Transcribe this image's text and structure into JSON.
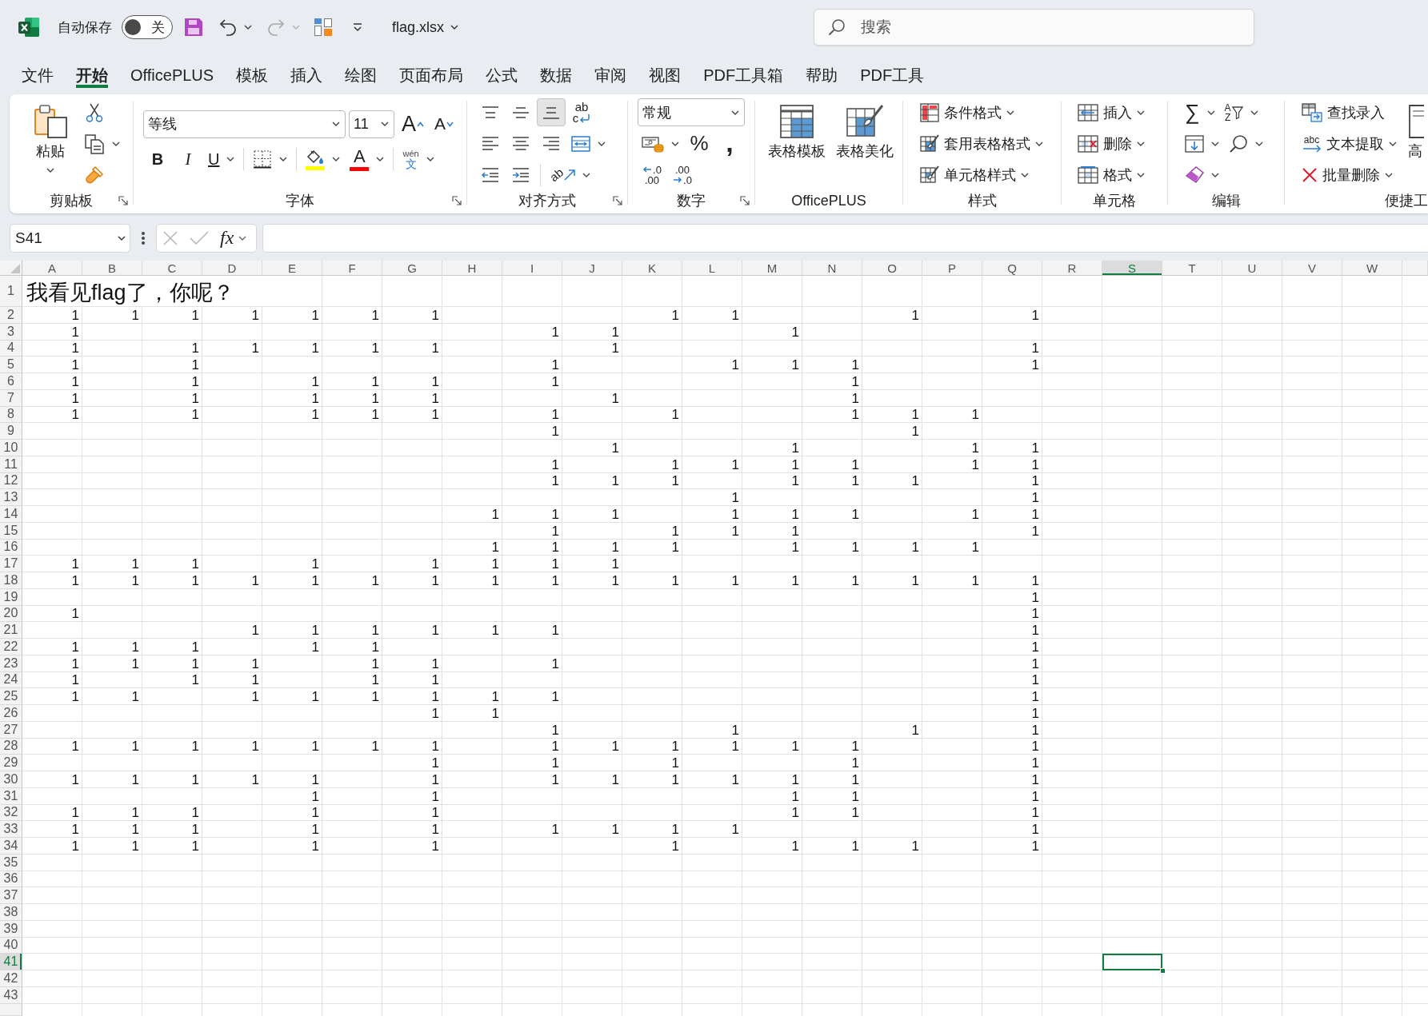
{
  "title_bar": {
    "autosave": {
      "label": "自动保存",
      "on": false,
      "state_text": "关"
    },
    "undo": {
      "disabled": false
    },
    "redo": {
      "disabled": true
    },
    "file_name": "flag.xlsx",
    "search": {
      "placeholder": "搜索"
    }
  },
  "tabs": [
    {
      "label": "文件",
      "selected": false
    },
    {
      "label": "开始",
      "selected": true
    },
    {
      "label": "OfficePLUS",
      "selected": false
    },
    {
      "label": "模板",
      "selected": false
    },
    {
      "label": "插入",
      "selected": false
    },
    {
      "label": "绘图",
      "selected": false
    },
    {
      "label": "页面布局",
      "selected": false
    },
    {
      "label": "公式",
      "selected": false
    },
    {
      "label": "数据",
      "selected": false
    },
    {
      "label": "审阅",
      "selected": false
    },
    {
      "label": "视图",
      "selected": false
    },
    {
      "label": "PDF工具箱",
      "selected": false
    },
    {
      "label": "帮助",
      "selected": false
    },
    {
      "label": "PDF工具",
      "selected": false
    }
  ],
  "ribbon": {
    "groups": [
      {
        "label": "剪贴板",
        "blocks": [
          {
            "kind": "large",
            "label": "粘贴"
          },
          {
            "kind": "stack",
            "lines": [
              {
                "items": [
                  {
                    "kind": "icon"
                  }
                ]
              },
              {
                "items": [
                  {
                    "kind": "icon"
                  }
                ]
              },
              {
                "items": [
                  {
                    "kind": "icon"
                  }
                ]
              }
            ]
          }
        ]
      },
      {
        "label": "字体",
        "blocks": [
          {
            "kind": "stack",
            "lines": [
              {
                "items": [
                  {
                    "kind": "combo",
                    "value": "等线"
                  },
                  {
                    "kind": "combo",
                    "value": "11"
                  },
                  {
                    "kind": "glyph",
                    "text": "A"
                  },
                  {
                    "kind": "glyph",
                    "text": "A"
                  }
                ]
              },
              {
                "items": [
                  {
                    "kind": "glyph",
                    "text": "B"
                  },
                  {
                    "kind": "glyph",
                    "text": "I"
                  },
                  {
                    "kind": "glyph",
                    "text": "U"
                  },
                  {
                    "kind": "divider"
                  },
                  {
                    "kind": "icon"
                  },
                  {
                    "kind": "divider"
                  },
                  {
                    "kind": "icon",
                    "color": "#ffff00"
                  },
                  {
                    "kind": "glyph",
                    "text": "A",
                    "color": "#ff0000"
                  },
                  {
                    "kind": "divider"
                  },
                  {
                    "kind": "glyph",
                    "text": "wén",
                    "subtext": "文"
                  }
                ]
              }
            ]
          }
        ]
      },
      {
        "label": "对齐方式",
        "blocks": [
          {
            "kind": "stack",
            "lines": [
              {
                "items": [
                  {
                    "kind": "icon",
                    "selected": false
                  },
                  {
                    "kind": "icon",
                    "selected": false
                  },
                  {
                    "kind": "icon",
                    "selected": true
                  },
                  {
                    "kind": "glyph",
                    "text": "ab",
                    "subtext": "c",
                    "selected": false
                  }
                ]
              },
              {
                "items": [
                  {
                    "kind": "icon",
                    "selected": false
                  },
                  {
                    "kind": "icon",
                    "selected": false
                  },
                  {
                    "kind": "icon",
                    "selected": false
                  },
                  {
                    "kind": "icon"
                  }
                ]
              },
              {
                "items": [
                  {
                    "kind": "icon"
                  },
                  {
                    "kind": "icon"
                  },
                  {
                    "kind": "divider"
                  },
                  {
                    "kind": "glyph",
                    "text": "ab"
                  }
                ]
              }
            ]
          }
        ]
      },
      {
        "label": "数字",
        "blocks": [
          {
            "kind": "stack",
            "lines": [
              {
                "items": [
                  {
                    "kind": "combo",
                    "value": "常规"
                  }
                ]
              },
              {
                "items": [
                  {
                    "kind": "icon"
                  },
                  {
                    "kind": "glyph",
                    "text": "%"
                  },
                  {
                    "kind": "glyph",
                    "text": ","
                  }
                ]
              },
              {
                "items": [
                  {
                    "kind": "glyph",
                    "text": ".0",
                    "subtext": ".00"
                  },
                  {
                    "kind": "glyph",
                    "text": ".00",
                    "subtext": ".0"
                  }
                ]
              }
            ]
          }
        ]
      },
      {
        "label": "OfficePLUS",
        "blocks": [
          {
            "kind": "large",
            "label": "表格模板"
          },
          {
            "kind": "large",
            "label": "表格美化"
          }
        ]
      },
      {
        "label": "样式",
        "blocks": [
          {
            "kind": "stack",
            "lines": [
              {
                "items": [
                  {
                    "kind": "small",
                    "label": "条件格式"
                  }
                ]
              },
              {
                "items": [
                  {
                    "kind": "small",
                    "label": "套用表格格式"
                  }
                ]
              },
              {
                "items": [
                  {
                    "kind": "small",
                    "label": "单元格样式"
                  }
                ]
              }
            ]
          }
        ]
      },
      {
        "label": "单元格",
        "blocks": [
          {
            "kind": "stack",
            "lines": [
              {
                "items": [
                  {
                    "kind": "small",
                    "label": "插入"
                  }
                ]
              },
              {
                "items": [
                  {
                    "kind": "small",
                    "label": "删除"
                  }
                ]
              },
              {
                "items": [
                  {
                    "kind": "small",
                    "label": "格式"
                  }
                ]
              }
            ]
          }
        ]
      },
      {
        "label": "编辑",
        "blocks": [
          {
            "kind": "stack",
            "lines": [
              {
                "items": [
                  {
                    "kind": "glyph",
                    "text": "∑"
                  },
                  {
                    "kind": "glyph",
                    "text": "A",
                    "subtext": "Z"
                  }
                ]
              },
              {
                "items": [
                  {
                    "kind": "icon"
                  },
                  {
                    "kind": "icon"
                  }
                ]
              },
              {
                "items": [
                  {
                    "kind": "icon"
                  }
                ]
              }
            ]
          }
        ]
      },
      {
        "label": "便捷工",
        "blocks": [
          {
            "kind": "stack",
            "lines": [
              {
                "items": [
                  {
                    "kind": "small",
                    "label": "查找录入"
                  }
                ]
              },
              {
                "items": [
                  {
                    "kind": "small",
                    "label": "文本提取",
                    "glyph": "abc"
                  }
                ]
              },
              {
                "items": [
                  {
                    "kind": "small",
                    "label": "批量删除"
                  }
                ]
              }
            ]
          },
          {
            "kind": "large",
            "label": "高"
          }
        ]
      }
    ]
  },
  "formula_bar": {
    "name_box": "S41",
    "cancel": {
      "disabled": true
    },
    "confirm": {
      "disabled": true
    },
    "function_label": "fx"
  },
  "sheet": {
    "columns": [
      {
        "label": "A",
        "selected": false
      },
      {
        "label": "B",
        "selected": false
      },
      {
        "label": "C",
        "selected": false
      },
      {
        "label": "D",
        "selected": false
      },
      {
        "label": "E",
        "selected": false
      },
      {
        "label": "F",
        "selected": false
      },
      {
        "label": "G",
        "selected": false
      },
      {
        "label": "H",
        "selected": false
      },
      {
        "label": "I",
        "selected": false
      },
      {
        "label": "J",
        "selected": false
      },
      {
        "label": "K",
        "selected": false
      },
      {
        "label": "L",
        "selected": false
      },
      {
        "label": "M",
        "selected": false
      },
      {
        "label": "N",
        "selected": false
      },
      {
        "label": "O",
        "selected": false
      },
      {
        "label": "P",
        "selected": false
      },
      {
        "label": "Q",
        "selected": false
      },
      {
        "label": "R",
        "selected": false
      },
      {
        "label": "S",
        "selected": true
      },
      {
        "label": "T",
        "selected": false
      },
      {
        "label": "U",
        "selected": false
      },
      {
        "label": "V",
        "selected": false
      },
      {
        "label": "W",
        "selected": false
      }
    ],
    "rows": [
      {
        "number": "1",
        "selected": false,
        "kind": "title",
        "cells": [
          "我看见flag了，你呢？"
        ]
      },
      {
        "number": "2",
        "selected": false,
        "kind": "data",
        "cells": [
          "1",
          "1",
          "1",
          "1",
          "1",
          "1",
          "1",
          null,
          null,
          null,
          "1",
          "1",
          null,
          null,
          "1",
          null,
          "1"
        ]
      },
      {
        "number": "3",
        "selected": false,
        "kind": "data",
        "cells": [
          "1",
          null,
          null,
          null,
          null,
          null,
          null,
          null,
          "1",
          "1",
          null,
          null,
          "1"
        ]
      },
      {
        "number": "4",
        "selected": false,
        "kind": "data",
        "cells": [
          "1",
          null,
          "1",
          "1",
          "1",
          "1",
          "1",
          null,
          null,
          "1",
          null,
          null,
          null,
          null,
          null,
          null,
          "1"
        ]
      },
      {
        "number": "5",
        "selected": false,
        "kind": "data",
        "cells": [
          "1",
          null,
          "1",
          null,
          null,
          null,
          null,
          null,
          "1",
          null,
          null,
          "1",
          "1",
          "1",
          null,
          null,
          "1"
        ]
      },
      {
        "number": "6",
        "selected": false,
        "kind": "data",
        "cells": [
          "1",
          null,
          "1",
          null,
          "1",
          "1",
          "1",
          null,
          "1",
          null,
          null,
          null,
          null,
          "1"
        ]
      },
      {
        "number": "7",
        "selected": false,
        "kind": "data",
        "cells": [
          "1",
          null,
          "1",
          null,
          "1",
          "1",
          "1",
          null,
          null,
          "1",
          null,
          null,
          null,
          "1"
        ]
      },
      {
        "number": "8",
        "selected": false,
        "kind": "data",
        "cells": [
          "1",
          null,
          "1",
          null,
          "1",
          "1",
          "1",
          null,
          "1",
          null,
          "1",
          null,
          null,
          "1",
          "1",
          "1"
        ]
      },
      {
        "number": "9",
        "selected": false,
        "kind": "data",
        "cells": [
          null,
          null,
          null,
          null,
          null,
          null,
          null,
          null,
          "1",
          null,
          null,
          null,
          null,
          null,
          "1"
        ]
      },
      {
        "number": "10",
        "selected": false,
        "kind": "data",
        "cells": [
          null,
          null,
          null,
          null,
          null,
          null,
          null,
          null,
          null,
          "1",
          null,
          null,
          "1",
          null,
          null,
          "1",
          "1"
        ]
      },
      {
        "number": "11",
        "selected": false,
        "kind": "data",
        "cells": [
          null,
          null,
          null,
          null,
          null,
          null,
          null,
          null,
          "1",
          null,
          "1",
          "1",
          "1",
          "1",
          null,
          "1",
          "1"
        ]
      },
      {
        "number": "12",
        "selected": false,
        "kind": "data",
        "cells": [
          null,
          null,
          null,
          null,
          null,
          null,
          null,
          null,
          "1",
          "1",
          "1",
          null,
          "1",
          "1",
          "1",
          null,
          "1"
        ]
      },
      {
        "number": "13",
        "selected": false,
        "kind": "data",
        "cells": [
          null,
          null,
          null,
          null,
          null,
          null,
          null,
          null,
          null,
          null,
          null,
          "1",
          null,
          null,
          null,
          null,
          "1"
        ]
      },
      {
        "number": "14",
        "selected": false,
        "kind": "data",
        "cells": [
          null,
          null,
          null,
          null,
          null,
          null,
          null,
          "1",
          "1",
          "1",
          null,
          "1",
          "1",
          "1",
          null,
          "1",
          "1"
        ]
      },
      {
        "number": "15",
        "selected": false,
        "kind": "data",
        "cells": [
          null,
          null,
          null,
          null,
          null,
          null,
          null,
          null,
          "1",
          null,
          "1",
          "1",
          "1",
          null,
          null,
          null,
          "1"
        ]
      },
      {
        "number": "16",
        "selected": false,
        "kind": "data",
        "cells": [
          null,
          null,
          null,
          null,
          null,
          null,
          null,
          "1",
          "1",
          "1",
          "1",
          null,
          "1",
          "1",
          "1",
          "1"
        ]
      },
      {
        "number": "17",
        "selected": false,
        "kind": "data",
        "cells": [
          "1",
          "1",
          "1",
          null,
          "1",
          null,
          "1",
          "1",
          "1",
          "1"
        ]
      },
      {
        "number": "18",
        "selected": false,
        "kind": "data",
        "cells": [
          "1",
          "1",
          "1",
          "1",
          "1",
          "1",
          "1",
          "1",
          "1",
          "1",
          "1",
          "1",
          "1",
          "1",
          "1",
          "1",
          "1"
        ]
      },
      {
        "number": "19",
        "selected": false,
        "kind": "data",
        "cells": [
          null,
          null,
          null,
          null,
          null,
          null,
          null,
          null,
          null,
          null,
          null,
          null,
          null,
          null,
          null,
          null,
          "1"
        ]
      },
      {
        "number": "20",
        "selected": false,
        "kind": "data",
        "cells": [
          "1",
          null,
          null,
          null,
          null,
          null,
          null,
          null,
          null,
          null,
          null,
          null,
          null,
          null,
          null,
          null,
          "1"
        ]
      },
      {
        "number": "21",
        "selected": false,
        "kind": "data",
        "cells": [
          null,
          null,
          null,
          "1",
          "1",
          "1",
          "1",
          "1",
          "1",
          null,
          null,
          null,
          null,
          null,
          null,
          null,
          "1"
        ]
      },
      {
        "number": "22",
        "selected": false,
        "kind": "data",
        "cells": [
          "1",
          "1",
          "1",
          null,
          "1",
          "1",
          null,
          null,
          null,
          null,
          null,
          null,
          null,
          null,
          null,
          null,
          "1"
        ]
      },
      {
        "number": "23",
        "selected": false,
        "kind": "data",
        "cells": [
          "1",
          "1",
          "1",
          "1",
          null,
          "1",
          "1",
          null,
          "1",
          null,
          null,
          null,
          null,
          null,
          null,
          null,
          "1"
        ]
      },
      {
        "number": "24",
        "selected": false,
        "kind": "data",
        "cells": [
          "1",
          null,
          "1",
          "1",
          null,
          "1",
          "1",
          null,
          null,
          null,
          null,
          null,
          null,
          null,
          null,
          null,
          "1"
        ]
      },
      {
        "number": "25",
        "selected": false,
        "kind": "data",
        "cells": [
          "1",
          "1",
          null,
          "1",
          "1",
          "1",
          "1",
          "1",
          "1",
          null,
          null,
          null,
          null,
          null,
          null,
          null,
          "1"
        ]
      },
      {
        "number": "26",
        "selected": false,
        "kind": "data",
        "cells": [
          null,
          null,
          null,
          null,
          null,
          null,
          "1",
          "1",
          null,
          null,
          null,
          null,
          null,
          null,
          null,
          null,
          "1"
        ]
      },
      {
        "number": "27",
        "selected": false,
        "kind": "data",
        "cells": [
          null,
          null,
          null,
          null,
          null,
          null,
          null,
          null,
          "1",
          null,
          null,
          "1",
          null,
          null,
          "1",
          null,
          "1"
        ]
      },
      {
        "number": "28",
        "selected": false,
        "kind": "data",
        "cells": [
          "1",
          "1",
          "1",
          "1",
          "1",
          "1",
          "1",
          null,
          "1",
          "1",
          "1",
          "1",
          "1",
          "1",
          null,
          null,
          "1"
        ]
      },
      {
        "number": "29",
        "selected": false,
        "kind": "data",
        "cells": [
          null,
          null,
          null,
          null,
          null,
          null,
          "1",
          null,
          "1",
          null,
          "1",
          null,
          null,
          "1",
          null,
          null,
          "1"
        ]
      },
      {
        "number": "30",
        "selected": false,
        "kind": "data",
        "cells": [
          "1",
          "1",
          "1",
          "1",
          "1",
          null,
          "1",
          null,
          "1",
          "1",
          "1",
          "1",
          "1",
          "1",
          null,
          null,
          "1"
        ]
      },
      {
        "number": "31",
        "selected": false,
        "kind": "data",
        "cells": [
          null,
          null,
          null,
          null,
          "1",
          null,
          "1",
          null,
          null,
          null,
          null,
          null,
          "1",
          "1",
          null,
          null,
          "1"
        ]
      },
      {
        "number": "32",
        "selected": false,
        "kind": "data",
        "cells": [
          "1",
          "1",
          "1",
          null,
          "1",
          null,
          "1",
          null,
          null,
          null,
          null,
          null,
          "1",
          "1",
          null,
          null,
          "1"
        ]
      },
      {
        "number": "33",
        "selected": false,
        "kind": "data",
        "cells": [
          "1",
          "1",
          "1",
          null,
          "1",
          null,
          "1",
          null,
          "1",
          "1",
          "1",
          "1",
          null,
          null,
          null,
          null,
          "1"
        ]
      },
      {
        "number": "34",
        "selected": false,
        "kind": "data",
        "cells": [
          "1",
          "1",
          "1",
          null,
          "1",
          null,
          "1",
          null,
          null,
          null,
          "1",
          null,
          "1",
          "1",
          "1",
          null,
          "1"
        ]
      },
      {
        "number": "35",
        "selected": false,
        "kind": "data"
      },
      {
        "number": "36",
        "selected": false,
        "kind": "data"
      },
      {
        "number": "37",
        "selected": false,
        "kind": "data"
      },
      {
        "number": "38",
        "selected": false,
        "kind": "data"
      },
      {
        "number": "39",
        "selected": false,
        "kind": "data"
      },
      {
        "number": "40",
        "selected": false,
        "kind": "data"
      },
      {
        "number": "41",
        "selected": true,
        "kind": "data"
      },
      {
        "number": "42",
        "selected": false,
        "kind": "data"
      },
      {
        "number": "43",
        "selected": false,
        "kind": "data"
      }
    ]
  }
}
